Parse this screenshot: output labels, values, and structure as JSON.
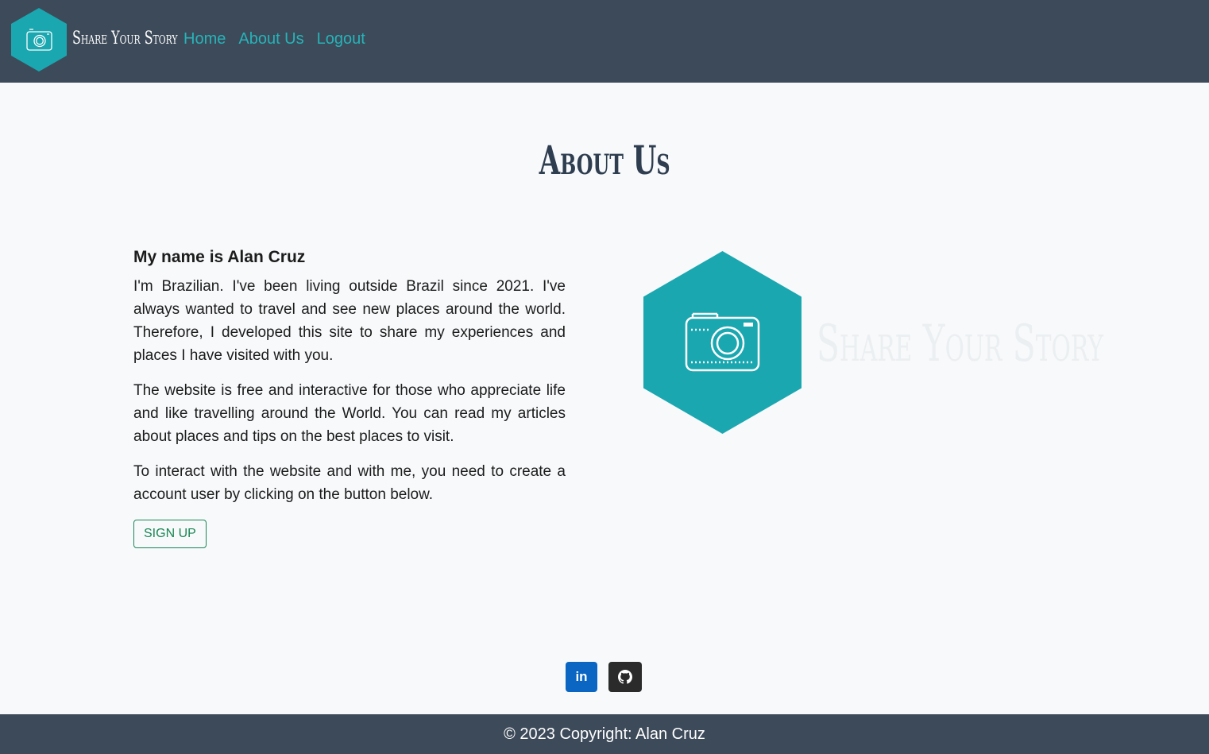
{
  "colors": {
    "navbar_bg": "#3d4a59",
    "accent_teal": "#1aa7b0",
    "nav_link": "#26b3b8",
    "title": "#2e3d4f",
    "signup_green": "#198754",
    "linkedin_blue": "#0a66c2",
    "github_dark": "#2b2b2b",
    "background": "#f7f9fb"
  },
  "navbar": {
    "brand_name": "Share Your Story",
    "brand_icon": "camera-icon",
    "links": [
      "Home",
      "About Us",
      "Logout"
    ]
  },
  "page": {
    "title": "About Us"
  },
  "about": {
    "heading": "My name is Alan Cruz",
    "paragraphs": [
      "I'm Brazilian. I've been living outside Brazil since 2021. I've always wanted to travel and see new places around the world. Therefore, I developed this site to share my experiences and places I have visited with you.",
      "The website is free and interactive for those who appreciate life and like travelling around the World. You can read my articles about places and tips on the best places to visit.",
      "To interact with the website and with me, you need to create a account user by clicking on the button below."
    ],
    "signup_label": "Sign Up"
  },
  "hero_logo": {
    "brand_name": "Share Your Story",
    "icon": "camera-icon"
  },
  "social": {
    "linkedin_label": "in",
    "linkedin_icon": "linkedin-icon",
    "github_icon": "github-icon"
  },
  "footer": {
    "copyright": "© 2023 Copyright: Alan Cruz"
  }
}
